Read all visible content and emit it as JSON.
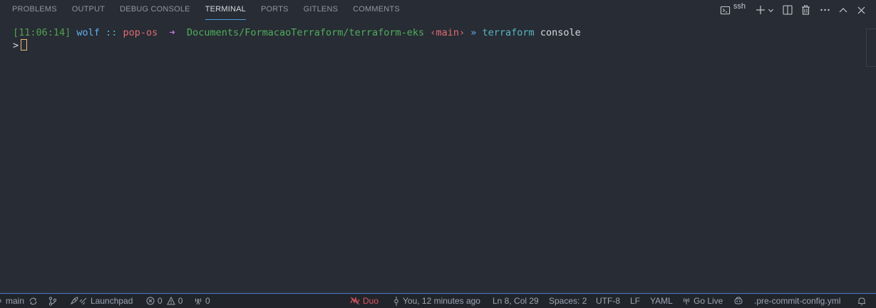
{
  "panel": {
    "tabs": [
      "PROBLEMS",
      "OUTPUT",
      "DEBUG CONSOLE",
      "TERMINAL",
      "PORTS",
      "GITLENS",
      "COMMENTS"
    ],
    "active_tab": "TERMINAL",
    "terminal_profile": "ssh",
    "icons": [
      "terminal-icon",
      "plus-icon",
      "chevron-down-icon",
      "split-icon",
      "trash-icon",
      "ellipsis-icon",
      "chevron-up-icon",
      "close-icon"
    ]
  },
  "terminal": {
    "time": "[11:06:14]",
    "user": "wolf",
    "separator": "::",
    "host": "pop-os",
    "arrow": "➜",
    "path": "Documents/FormacaoTerraform/terraform-eks",
    "branch": "‹main›",
    "prompt_chevron": "»",
    "command": "terraform",
    "argument": "console",
    "prompt": ">"
  },
  "statusbar": {
    "branch": "main",
    "launchpad": "Launchpad",
    "errors": "0",
    "warnings": "0",
    "ports": "0",
    "duo": "Duo",
    "blame": "You, 12 minutes ago",
    "position": "Ln 8, Col 29",
    "spaces": "Spaces: 2",
    "encoding": "UTF-8",
    "eol": "LF",
    "language": "YAML",
    "golive": "Go Live",
    "file": ".pre-commit-config.yml"
  },
  "colors": {
    "accent": "#4d9de0",
    "background": "#282c34",
    "statusbar_border": "#4d78cc",
    "duo": "#e0555f"
  }
}
